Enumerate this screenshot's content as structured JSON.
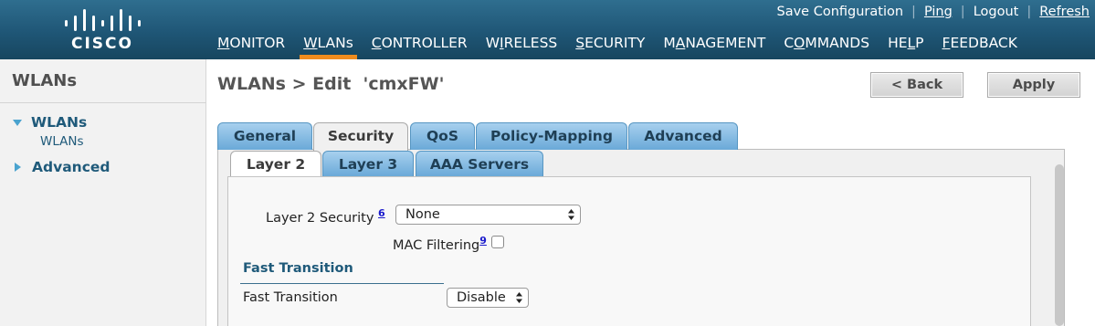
{
  "brand": {
    "logo_text": "CISCO"
  },
  "topbar": {
    "links": [
      {
        "label": "Save Configuration"
      },
      {
        "label": "Ping"
      },
      {
        "label": "Logout"
      },
      {
        "label": "Refresh"
      }
    ]
  },
  "nav": {
    "items": [
      {
        "pre": "",
        "u": "M",
        "post": "ONITOR"
      },
      {
        "pre": "",
        "u": "W",
        "post": "LANs"
      },
      {
        "pre": "",
        "u": "C",
        "post": "ONTROLLER"
      },
      {
        "pre": "W",
        "u": "I",
        "post": "RELESS"
      },
      {
        "pre": "",
        "u": "S",
        "post": "ECURITY"
      },
      {
        "pre": "M",
        "u": "A",
        "post": "NAGEMENT"
      },
      {
        "pre": "C",
        "u": "O",
        "post": "MMANDS"
      },
      {
        "pre": "HE",
        "u": "L",
        "post": "P"
      },
      {
        "pre": "",
        "u": "F",
        "post": "EEDBACK"
      }
    ],
    "active_index": 1,
    "active_color": "#f08c1e"
  },
  "sidebar": {
    "title": "WLANs",
    "group1": "WLANs",
    "sub1": "WLANs",
    "group2": "Advanced"
  },
  "page": {
    "title": "WLANs > Edit  'cmxFW'",
    "back_label": "< Back",
    "apply_label": "Apply"
  },
  "tabs": [
    "General",
    "Security",
    "QoS",
    "Policy-Mapping",
    "Advanced"
  ],
  "subtabs": [
    "Layer 2",
    "Layer 3",
    "AAA Servers"
  ],
  "form": {
    "l2sec_label": "Layer 2 Security",
    "l2sec_note": "6",
    "l2sec_value": "None",
    "mac_label": "MAC Filtering",
    "mac_note": "9",
    "mac_checked": false,
    "section_title": "Fast Transition",
    "ft_label": "Fast Transition",
    "ft_value": "Disable"
  }
}
